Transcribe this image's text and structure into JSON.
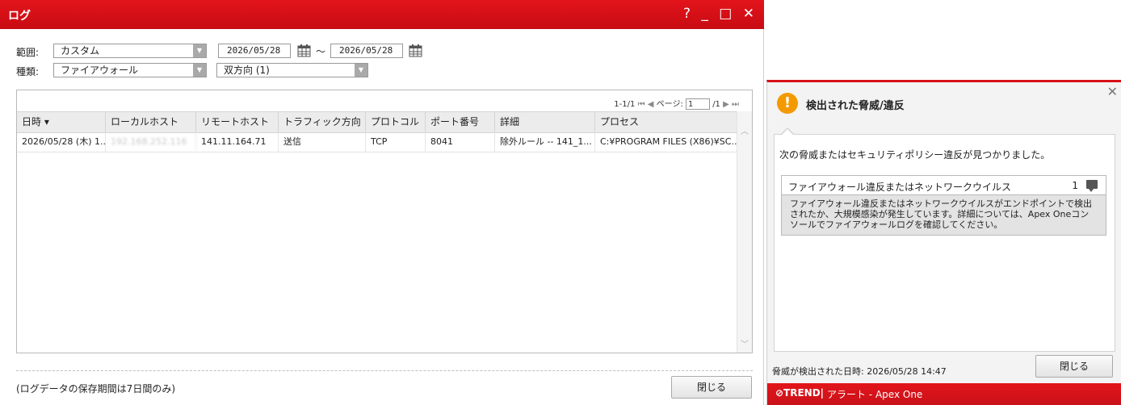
{
  "log_window": {
    "title": "ログ",
    "controls": "? _ □ ✕",
    "range_label": "範囲:",
    "range_value": "カスタム",
    "date_from": "2026/05/28",
    "date_sep": "～",
    "date_to": "2026/05/28",
    "type_label": "種類:",
    "type_value": "ファイアウォール",
    "direction_value": "双方向 (1)",
    "pager": {
      "range": "1-1/1",
      "first": "⏮",
      "prev": "◀",
      "page_label": "ページ:",
      "page_value": "1",
      "total": "/1",
      "next": "▶",
      "last": "⏭"
    },
    "columns": [
      "日時 ▾",
      "ローカルホスト",
      "リモートホスト",
      "トラフィック方向",
      "プロトコル",
      "ポート番号",
      "詳細",
      "プロセス"
    ],
    "rows": [
      [
        "2026/05/28 (木) 1...",
        "192.168.252.116",
        "141.11.164.71",
        "送信",
        "TCP",
        "8041",
        "除外ルール -- 141_1...",
        "C:¥PROGRAM FILES (X86)¥SC..."
      ]
    ],
    "retention_note": "(ログデータの保存期間は7日間のみ)",
    "close_label": "閉じる"
  },
  "alert": {
    "title": "検出された脅威/違反",
    "intro": "次の脅威またはセキュリティポリシー違反が見つかりました。",
    "threat_name": "ファイアウォール違反またはネットワークウイルス",
    "threat_count": "1",
    "threat_description": "ファイアウォール違反またはネットワークウイルスがエンドポイントで検出されたか、大規模感染が発生しています。詳細については、Apex Oneコンソールでファイアウォールログを確認してください。",
    "detected_time": "脅威が検出された日時: 2026/05/28 14:47",
    "close_label": "閉じる",
    "brand": "⊘TREND|",
    "footer_text": "アラート - Apex One"
  },
  "colors": {
    "accent_red": "#d71118",
    "warning_orange": "#f39a00",
    "header_gray": "#ececec"
  }
}
